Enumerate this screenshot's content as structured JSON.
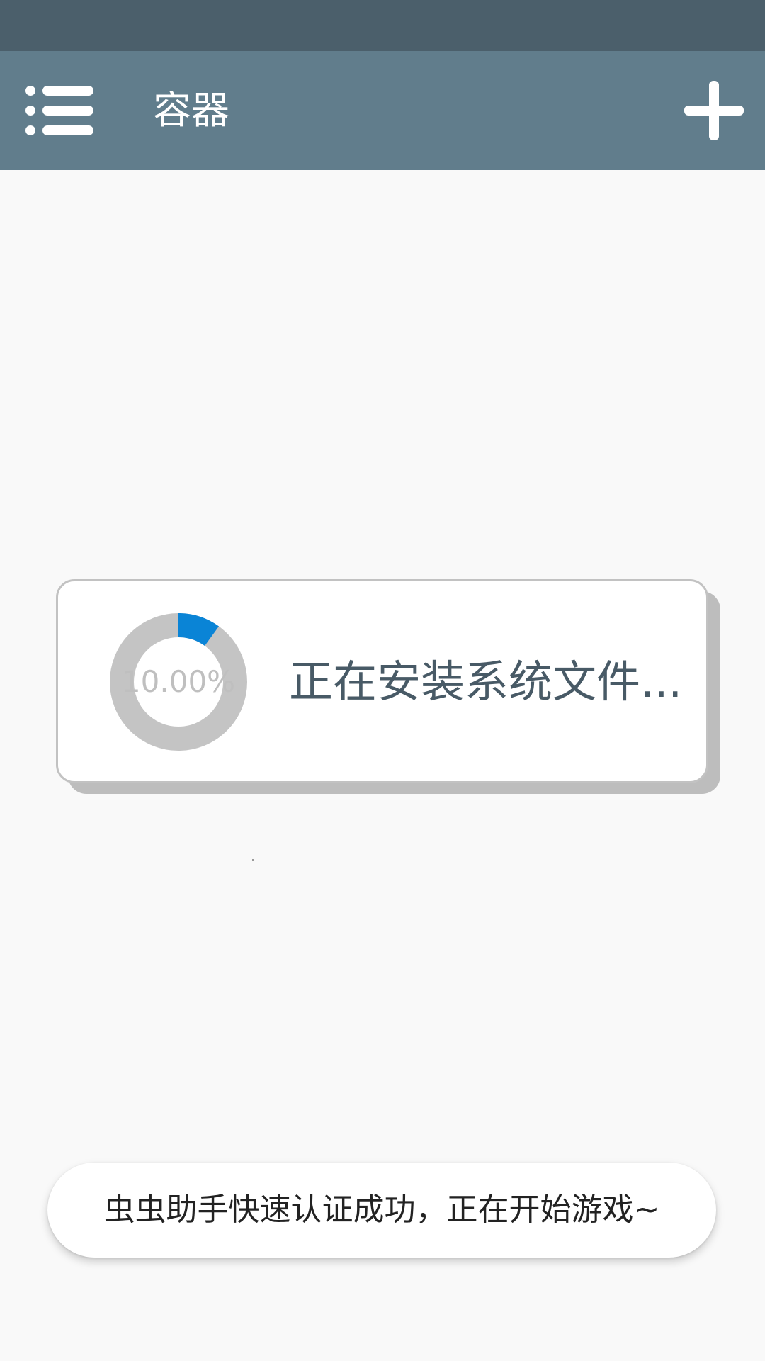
{
  "app_bar": {
    "title": "容器",
    "menu_icon": "list-menu-icon",
    "add_icon": "plus-icon",
    "background": "#617d8c",
    "status_bar_color": "#4b5f6b"
  },
  "install_card": {
    "progress_fraction": 0.1,
    "progress_label": "10.00%",
    "status_text": "正在安装系统文件...",
    "progress_color": "#0a84d6",
    "track_color": "#c4c4c4"
  },
  "toast": {
    "message": "虫虫助手快速认证成功，正在开始游戏~"
  }
}
